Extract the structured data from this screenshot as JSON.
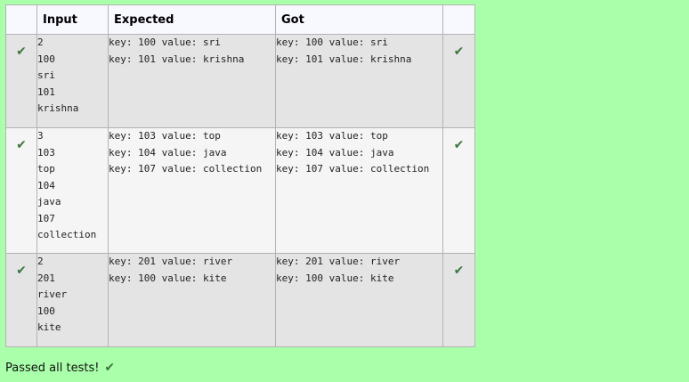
{
  "table": {
    "headers": [
      "",
      "Input",
      "Expected",
      "Got",
      ""
    ],
    "rows": [
      {
        "input": "2\n100\nsri\n101\nkrishna",
        "expected": "key: 100 value: sri\nkey: 101 value: krishna",
        "got": "key: 100 value: sri\nkey: 101 value: krishna"
      },
      {
        "input": "3\n103\ntop\n104\njava\n107\ncollection",
        "expected": "key: 103 value: top\nkey: 104 value: java\nkey: 107 value: collection",
        "got": "key: 103 value: top\nkey: 104 value: java\nkey: 107 value: collection"
      },
      {
        "input": "2\n201\nriver\n100\nkite",
        "expected": "key: 201 value: river\nkey: 100 value: kite",
        "got": "key: 201 value: river\nkey: 100 value: kite"
      }
    ]
  },
  "status": {
    "message": "Passed all tests!"
  },
  "icons": {
    "pass": "check-mark-icon",
    "glyph": "✔"
  },
  "colors": {
    "background": "#aaffaa",
    "check": "#3c763d"
  }
}
